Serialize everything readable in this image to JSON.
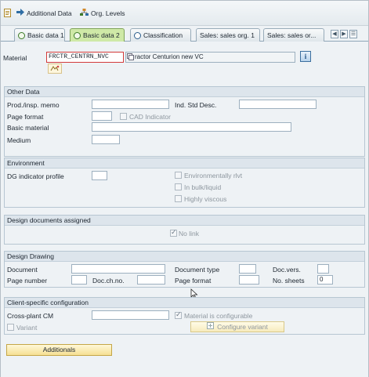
{
  "toolbar": {
    "additional_data": "Additional Data",
    "org_levels": "Org. Levels"
  },
  "tabs": [
    {
      "label": "Basic data 1"
    },
    {
      "label": "Basic data 2"
    },
    {
      "label": "Classification"
    },
    {
      "label": "Sales: sales org. 1"
    },
    {
      "label": "Sales: sales or..."
    }
  ],
  "material": {
    "label": "Material",
    "number": "FRCTR_CENTRN_NVC",
    "description": "ractor Centurion new VC",
    "info_icon": "i"
  },
  "other_data": {
    "title": "Other Data",
    "prod_memo_label": "Prod./insp. memo",
    "ind_std_desc_label": "Ind. Std Desc.",
    "page_format_label": "Page format",
    "cad_indicator_label": "CAD Indicator",
    "basic_material_label": "Basic material",
    "medium_label": "Medium"
  },
  "environment": {
    "title": "Environment",
    "dg_indicator_label": "DG indicator profile",
    "env_relevant_label": "Environmentally rlvt",
    "bulk_liquid_label": "In bulk/liquid",
    "highly_viscous_label": "Highly viscous"
  },
  "design_docs": {
    "title": "Design documents assigned",
    "no_link_label": "No link",
    "no_link_checked": true
  },
  "design_drawing": {
    "title": "Design Drawing",
    "document_label": "Document",
    "document_type_label": "Document type",
    "doc_vers_label": "Doc.vers.",
    "page_number_label": "Page number",
    "doc_ch_no_label": "Doc.ch.no.",
    "page_format_label": "Page format",
    "no_sheets_label": "No. sheets",
    "no_sheets_value": "0"
  },
  "client_config": {
    "title": "Client-specific configuration",
    "cross_plant_label": "Cross-plant CM",
    "material_configurable_label": "Material is configurable",
    "material_configurable_checked": true,
    "variant_label": "Variant",
    "configure_variant_label": "Configure variant"
  },
  "footer": {
    "additionals_label": "Additionals"
  },
  "colors": {
    "active_tab": "#cfe9a7",
    "button_yellow": "#f5df93",
    "group_header": "#dde5ec"
  }
}
